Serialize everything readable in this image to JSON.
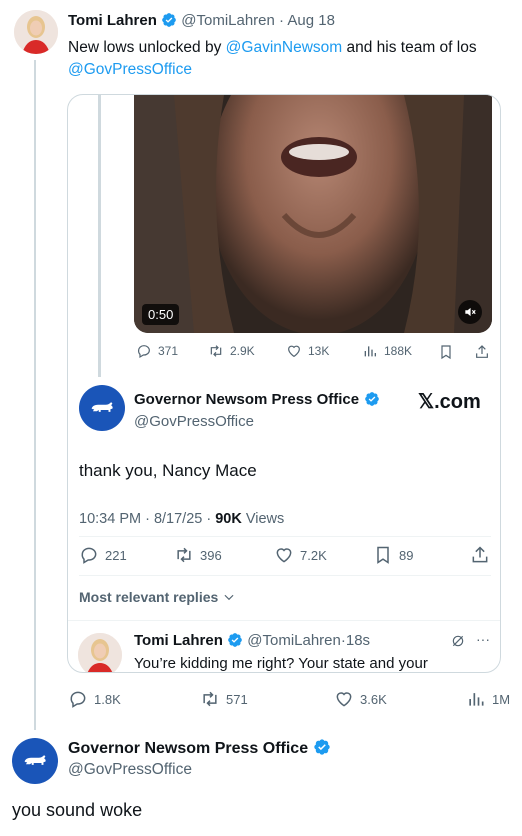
{
  "main_tweet": {
    "author": "Tomi Lahren",
    "handle": "@TomiLahren",
    "dot": "·",
    "date": "Aug 18",
    "text_prefix": "New lows unlocked by ",
    "mention1": "@GavinNewsom",
    "text_middle": " and his team of los",
    "mention2": "@GovPressOffice",
    "actions": {
      "replies": "1.8K",
      "retweets": "571",
      "likes": "3.6K",
      "views": "1M"
    }
  },
  "quoted": {
    "video": {
      "duration": "0:50"
    },
    "context_actions": {
      "replies": "371",
      "retweets": "2.9K",
      "likes": "13K",
      "views": "188K"
    },
    "author": "Governor Newsom Press Office",
    "handle": "@GovPressOffice",
    "platform": "𝕏.com",
    "text": "thank you, Nancy Mace",
    "time": "10:34 PM · 8/17/25 · ",
    "views_count": "90K",
    "views_label": " Views",
    "actions": {
      "replies": "221",
      "retweets": "396",
      "likes": "7.2K",
      "bookmarks": "89"
    },
    "replies_filter": "Most relevant replies",
    "reply": {
      "author": "Tomi Lahren",
      "handle": "@TomiLahren",
      "dot": "·",
      "time": "18s",
      "text": "You’re kidding me right? Your state and your",
      "more": "···"
    }
  },
  "reply_tweet": {
    "author": "Governor Newsom Press Office",
    "handle": "@GovPressOffice",
    "text": "you sound woke"
  },
  "colors": {
    "accent": "#1d9bf0",
    "muted": "#536471",
    "newsom_blue": "#1a55b8"
  }
}
